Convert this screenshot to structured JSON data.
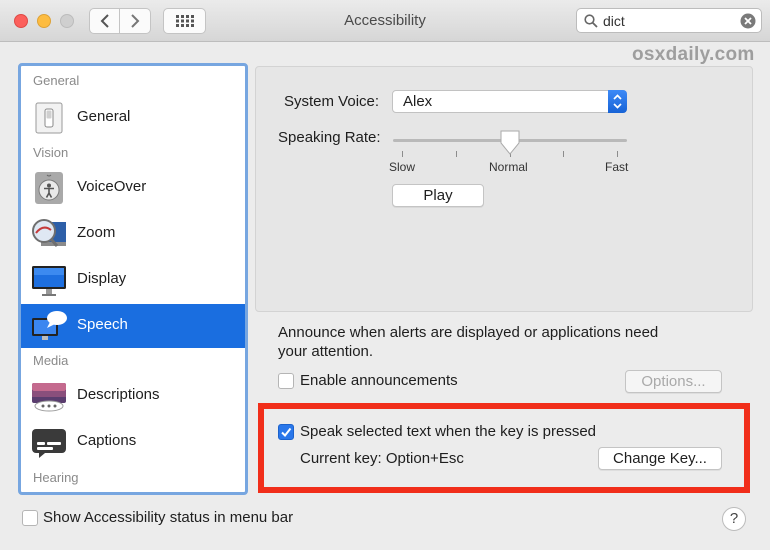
{
  "window": {
    "title": "Accessibility"
  },
  "toolbar": {
    "back_icon": "chevron-left-icon",
    "forward_icon": "chevron-right-icon",
    "grid_icon": "grid-icon"
  },
  "search": {
    "value": "dict",
    "placeholder": "Search"
  },
  "watermark": "osxdaily.com",
  "sidebar": {
    "sections": [
      {
        "header": "General"
      },
      {
        "header": "Vision"
      },
      {
        "header": "Media"
      },
      {
        "header": "Hearing"
      }
    ],
    "items": [
      {
        "label": "General",
        "icon": "switch-icon"
      },
      {
        "label": "VoiceOver",
        "icon": "voiceover-icon"
      },
      {
        "label": "Zoom",
        "icon": "zoom-icon"
      },
      {
        "label": "Display",
        "icon": "display-icon"
      },
      {
        "label": "Speech",
        "icon": "speech-icon",
        "selected": true
      },
      {
        "label": "Descriptions",
        "icon": "descriptions-icon"
      },
      {
        "label": "Captions",
        "icon": "captions-icon"
      }
    ]
  },
  "speech": {
    "voice_label": "System Voice:",
    "voice_value": "Alex",
    "rate_label": "Speaking Rate:",
    "rate_slow": "Slow",
    "rate_normal": "Normal",
    "rate_fast": "Fast",
    "rate_value": 0.5,
    "play_label": "Play"
  },
  "announce": {
    "text_line1": "Announce when alerts are displayed or applications need",
    "text_line2": "your attention.",
    "enable_label": "Enable announcements",
    "enable_checked": false,
    "options_label": "Options..."
  },
  "speak_selected": {
    "label": "Speak selected text when the key is pressed",
    "checked": true,
    "current_key": "Current key: Option+Esc",
    "change_key_label": "Change Key..."
  },
  "footer": {
    "status_label": "Show Accessibility status in menu bar",
    "status_checked": false,
    "help_label": "?"
  },
  "colors": {
    "accent": "#1a6ee0",
    "highlight": "#f12e1a",
    "sidebar_border": "#77a6e0"
  }
}
